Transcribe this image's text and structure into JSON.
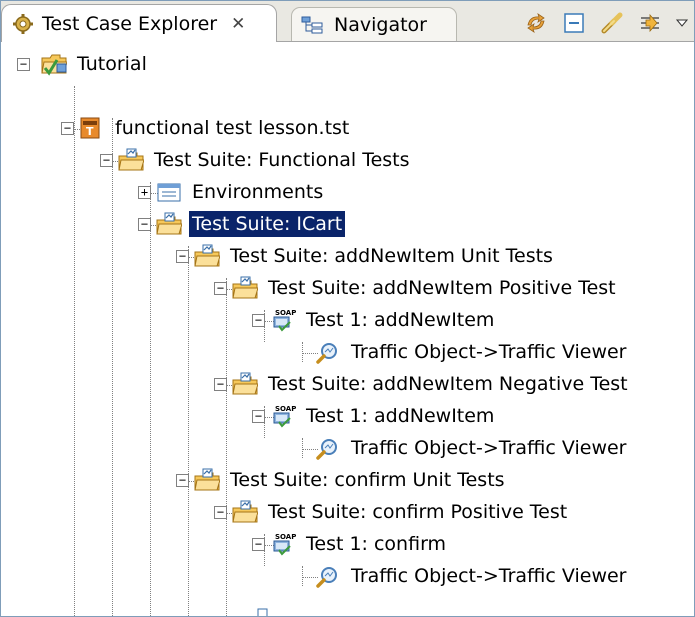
{
  "tabs": [
    {
      "label": "Test Case Explorer",
      "close": "✕",
      "icon": "gear-icon",
      "active": true
    },
    {
      "label": "Navigator",
      "icon": "navigator-icon",
      "active": false
    }
  ],
  "toolbar": {
    "icons": [
      "sync-icon",
      "collapse-all-icon",
      "link-icon",
      "filter-icon",
      "view-menu-icon"
    ]
  },
  "tree": [
    {
      "label": "Tutorial",
      "icon": "project-folder-icon",
      "expander": "−"
    },
    {
      "label": "functional test lesson.tst",
      "icon": "test-file-icon",
      "expander": "−"
    },
    {
      "label": "Test Suite: Functional Tests",
      "icon": "test-suite-icon",
      "expander": "−"
    },
    {
      "label": "Environments",
      "icon": "environments-icon",
      "expander": "+"
    },
    {
      "label": "Test Suite: ICart",
      "icon": "test-suite-icon",
      "expander": "−",
      "selected": true
    },
    {
      "label": "Test Suite: addNewItem Unit Tests",
      "icon": "test-suite-icon",
      "expander": "−"
    },
    {
      "label": "Test Suite: addNewItem Positive Test",
      "icon": "test-suite-icon",
      "expander": "−"
    },
    {
      "label": "Test 1: addNewItem",
      "icon": "soap-test-icon",
      "expander": "−"
    },
    {
      "label": "Traffic Object->Traffic Viewer",
      "icon": "traffic-viewer-icon"
    },
    {
      "label": "Test Suite: addNewItem Negative Test",
      "icon": "test-suite-icon",
      "expander": "−"
    },
    {
      "label": "Test 1: addNewItem",
      "icon": "soap-test-icon",
      "expander": "−"
    },
    {
      "label": "Traffic Object->Traffic Viewer",
      "icon": "traffic-viewer-icon"
    },
    {
      "label": "Test Suite: confirm Unit Tests",
      "icon": "test-suite-icon",
      "expander": "−"
    },
    {
      "label": "Test Suite: confirm Positive Test",
      "icon": "test-suite-icon",
      "expander": "−"
    },
    {
      "label": "Test 1: confirm",
      "icon": "soap-test-icon",
      "expander": "−"
    },
    {
      "label": "Traffic Object->Traffic Viewer",
      "icon": "traffic-viewer-icon"
    }
  ]
}
